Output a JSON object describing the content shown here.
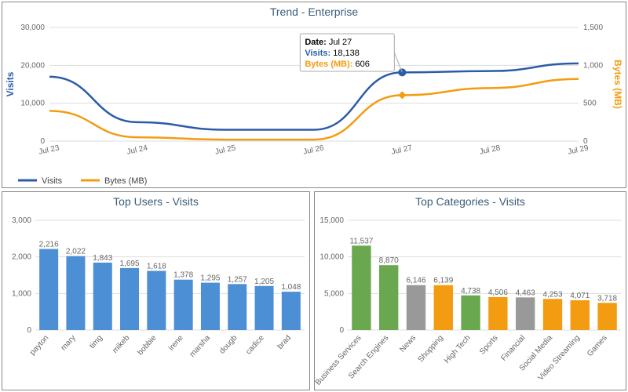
{
  "trend": {
    "title": "Trend - Enterprise",
    "left_axis": "Visits",
    "right_axis": "Bytes (MB)",
    "legend": {
      "visits": "Visits",
      "bytes": "Bytes (MB)"
    },
    "tooltip": {
      "date_label": "Date",
      "date_value": "Jul 27",
      "visits_label": "Visits",
      "visits_value": "18,138",
      "bytes_label": "Bytes (MB)",
      "bytes_value": "606"
    }
  },
  "users": {
    "title": "Top Users - Visits"
  },
  "cats": {
    "title": "Top Categories - Visits"
  },
  "chart_data": [
    {
      "type": "line",
      "title": "Trend - Enterprise",
      "categories": [
        "Jul 23",
        "Jul 24",
        "Jul 25",
        "Jul 26",
        "Jul 27",
        "Jul 28",
        "Jul 29"
      ],
      "series": [
        {
          "name": "Visits",
          "axis": "left",
          "color": "#2b5ca8",
          "values": [
            17000,
            5000,
            3000,
            3000,
            18138,
            18500,
            20500
          ]
        },
        {
          "name": "Bytes (MB)",
          "axis": "right",
          "color": "#f39c12",
          "values": [
            400,
            50,
            20,
            20,
            606,
            700,
            820
          ]
        }
      ],
      "left_axis": {
        "label": "Visits",
        "min": 0,
        "max": 30000,
        "ticks": [
          0,
          10000,
          20000,
          30000
        ]
      },
      "right_axis": {
        "label": "Bytes (MB)",
        "min": 0,
        "max": 1500,
        "ticks": [
          0,
          500,
          1000,
          1500
        ]
      },
      "highlight_index": 4
    },
    {
      "type": "bar",
      "title": "Top Users - Visits",
      "categories": [
        "payton",
        "mary",
        "timg",
        "mikeb",
        "bobbie",
        "irene",
        "marsha",
        "dougb",
        "cadice",
        "brad"
      ],
      "values": [
        2216,
        2022,
        1843,
        1695,
        1618,
        1378,
        1295,
        1257,
        1205,
        1048
      ],
      "ylim": [
        0,
        3000
      ],
      "yticks": [
        0,
        1000,
        2000,
        3000
      ],
      "color": "#4c8fd4"
    },
    {
      "type": "bar",
      "title": "Top Categories - Visits",
      "categories": [
        "Business Services",
        "Search Engines",
        "News",
        "Shopping",
        "High Tech",
        "Sports",
        "Financial",
        "Social Media",
        "Video Streaming",
        "Games"
      ],
      "values": [
        11537,
        8870,
        6146,
        6139,
        4738,
        4506,
        4463,
        4253,
        4071,
        3718
      ],
      "ylim": [
        0,
        15000
      ],
      "yticks": [
        0,
        5000,
        10000,
        15000
      ],
      "colors": [
        "#6aa84f",
        "#6aa84f",
        "#999999",
        "#f39c12",
        "#6aa84f",
        "#f39c12",
        "#999999",
        "#f39c12",
        "#f39c12",
        "#f39c12"
      ]
    }
  ]
}
